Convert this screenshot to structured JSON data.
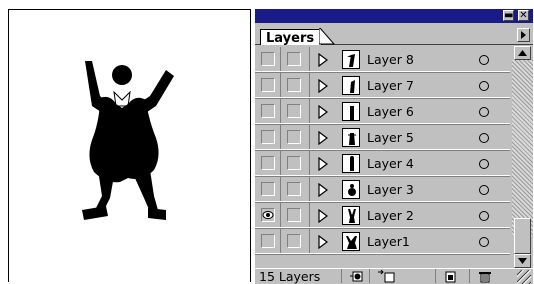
{
  "palette": {
    "tab_label": "Layers",
    "layer_count": "15 Layers",
    "layers": [
      {
        "name": "Layer 8",
        "visible": false
      },
      {
        "name": "Layer 7",
        "visible": false
      },
      {
        "name": "Layer 6",
        "visible": false
      },
      {
        "name": "Layer 5",
        "visible": false
      },
      {
        "name": "Layer 4",
        "visible": false
      },
      {
        "name": "Layer 3",
        "visible": false
      },
      {
        "name": "Layer 2",
        "visible": true
      },
      {
        "name": "Layer1",
        "visible": false
      }
    ],
    "icons": {
      "minimize": "minimize-icon",
      "close": "close-icon",
      "menu": "palette-menu-arrow-icon",
      "expand": "expand-triangle-icon",
      "target": "target-circle-icon",
      "eye": "eye-icon",
      "new_sublayer": "new-sublayer-icon",
      "new_layer": "new-layer-icon",
      "trash": "trash-icon"
    },
    "colors": {
      "titlebar": "#1b1b88",
      "panel": "#c0c0c0"
    }
  }
}
